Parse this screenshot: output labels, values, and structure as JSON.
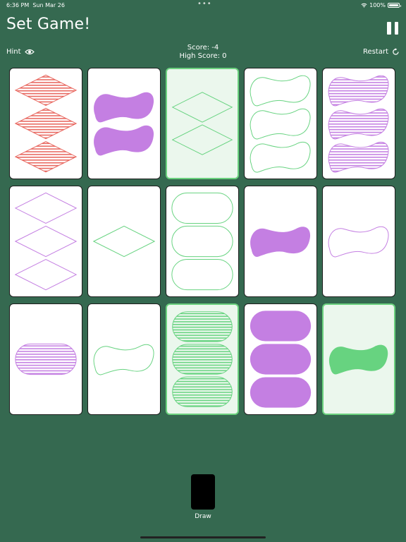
{
  "status_bar": {
    "time": "6:36 PM",
    "date": "Sun Mar 26",
    "battery": "100%"
  },
  "header": {
    "title": "Set Game!"
  },
  "toolbar": {
    "hint_label": "Hint",
    "restart_label": "Restart",
    "score_label": "Score: -4",
    "high_score_label": "High Score: 0"
  },
  "colors": {
    "red": "#e8675f",
    "purple": "#c47fe2",
    "green": "#67d380",
    "background": "#356950"
  },
  "cards": [
    {
      "shape": "diamond",
      "count": 3,
      "color": "red",
      "fill": "striped",
      "selected": false
    },
    {
      "shape": "squiggle",
      "count": 2,
      "color": "purple",
      "fill": "solid",
      "selected": false
    },
    {
      "shape": "diamond",
      "count": 2,
      "color": "green",
      "fill": "outline",
      "selected": true
    },
    {
      "shape": "squiggle",
      "count": 3,
      "color": "green",
      "fill": "outline",
      "selected": false
    },
    {
      "shape": "squiggle",
      "count": 3,
      "color": "purple",
      "fill": "striped",
      "selected": false
    },
    {
      "shape": "diamond",
      "count": 3,
      "color": "purple",
      "fill": "outline",
      "selected": false
    },
    {
      "shape": "diamond",
      "count": 1,
      "color": "green",
      "fill": "outline",
      "selected": false
    },
    {
      "shape": "oval",
      "count": 3,
      "color": "green",
      "fill": "outline",
      "selected": false
    },
    {
      "shape": "squiggle",
      "count": 1,
      "color": "purple",
      "fill": "solid",
      "selected": false
    },
    {
      "shape": "squiggle",
      "count": 1,
      "color": "purple",
      "fill": "outline",
      "selected": false
    },
    {
      "shape": "oval",
      "count": 1,
      "color": "purple",
      "fill": "striped",
      "selected": false
    },
    {
      "shape": "squiggle",
      "count": 1,
      "color": "green",
      "fill": "outline",
      "selected": false
    },
    {
      "shape": "oval",
      "count": 3,
      "color": "green",
      "fill": "striped",
      "selected": true
    },
    {
      "shape": "oval",
      "count": 3,
      "color": "purple",
      "fill": "solid",
      "selected": false
    },
    {
      "shape": "squiggle",
      "count": 1,
      "color": "green",
      "fill": "solid",
      "selected": true
    }
  ],
  "deck": {
    "draw_label": "Draw"
  }
}
